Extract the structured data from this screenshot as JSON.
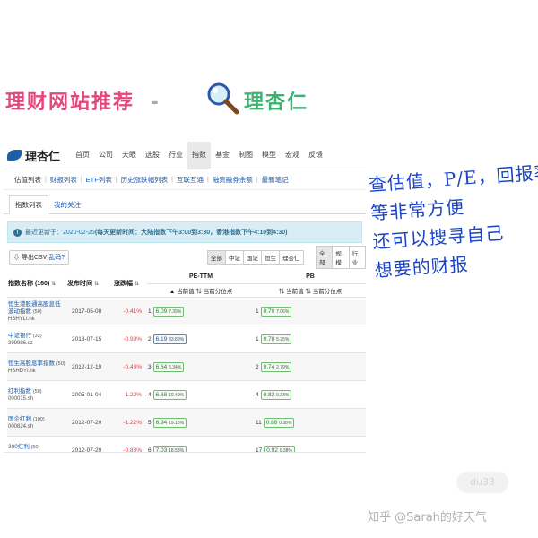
{
  "title": {
    "part1": "理财网站推荐",
    "dash": "-",
    "part2": "理杏仁"
  },
  "brand": "理杏仁",
  "topnav": [
    "首页",
    "公司",
    "天眼",
    "选股",
    "行业",
    "指数",
    "基金",
    "制图",
    "模型",
    "宏观",
    "反馈"
  ],
  "topnav_active": 5,
  "subnav": [
    "估值列表",
    "财报列表",
    "ETF列表",
    "历史涨跌幅列表",
    "互联互通",
    "融资融券余额",
    "最新笔记"
  ],
  "tabs": [
    "指数列表",
    "我的关注"
  ],
  "notice": {
    "prefix": "最近更新于：",
    "date": "2020-02-25",
    "detail": "(每天更新时间：大陆指数下午3:00到3:30，香港指数下午4:10到4:30)"
  },
  "csv_button": {
    "label": "导出CSV",
    "help": "乱码?"
  },
  "filter_group1": [
    "全部",
    "中证",
    "国证",
    "恒生",
    "理杏仁"
  ],
  "filter_group2": [
    "全部",
    "规模",
    "行业"
  ],
  "table": {
    "headers": {
      "name": "指数名称 (160)",
      "date": "发布时间",
      "change": "涨跌幅",
      "pe": "PE-TTM",
      "pb": "PB",
      "current": "当前值",
      "percentile": "当前分位点"
    },
    "rows": [
      {
        "name": "恒生港股通高股息低波动指数",
        "count": "(50)",
        "code": "HSHYLI.hk",
        "date": "2017-05-08",
        "change": "-0.41%",
        "pe_rank": "1",
        "pe_val": "6.09",
        "pe_pct": "7.39%",
        "pb_rank": "1",
        "pb_val": "0.70",
        "pb_pct": "7.06%"
      },
      {
        "name": "中证银行",
        "count": "(32)",
        "code": "399986.sz",
        "date": "2013-07-15",
        "change": "-0.99%",
        "pe_rank": "2",
        "pe_val": "6.19",
        "pe_pct": "33.89%",
        "pb_rank": "1",
        "pb_val": "0.78",
        "pb_pct": "5.25%"
      },
      {
        "name": "恒生高股息率指数",
        "count": "(50)",
        "code": "HSHDYI.hk",
        "date": "2012-12-10",
        "change": "-0.43%",
        "pe_rank": "3",
        "pe_val": "6.64",
        "pe_pct": "5.34%",
        "pb_rank": "2",
        "pb_val": "0.74",
        "pb_pct": "2.79%"
      },
      {
        "name": "红利指数",
        "count": "(50)",
        "code": "000015.sh",
        "date": "2005-01-04",
        "change": "-1.22%",
        "pe_rank": "4",
        "pe_val": "6.68",
        "pe_pct": "10.49%",
        "pb_rank": "4",
        "pb_val": "0.82",
        "pb_pct": "0.33%"
      },
      {
        "name": "国企红利",
        "count": "(100)",
        "code": "000824.sh",
        "date": "2012-07-20",
        "change": "-1.22%",
        "pe_rank": "5",
        "pe_val": "6.94",
        "pe_pct": "19.18%",
        "pb_rank": "11",
        "pb_val": "0.88",
        "pb_pct": "0.38%"
      },
      {
        "name": "300红利",
        "count": "(50)",
        "code": "000821.sh",
        "date": "2012-07-20",
        "change": "-0.88%",
        "pe_rank": "6",
        "pe_val": "7.03",
        "pe_pct": "18.53%",
        "pb_rank": "17",
        "pb_val": "0.92",
        "pb_pct": "0.38%"
      }
    ]
  },
  "notes": [
    "查估值，P/E，回报率",
    "等非常方便",
    "还可以搜寻自己",
    "想要的财报"
  ],
  "watermark": "知乎 @Sarah的好天气",
  "colors": {
    "link": "#1e5aa8",
    "notes_ink": "#1c43c2",
    "negative": "#e23b3b",
    "good": "#2e7d32"
  }
}
